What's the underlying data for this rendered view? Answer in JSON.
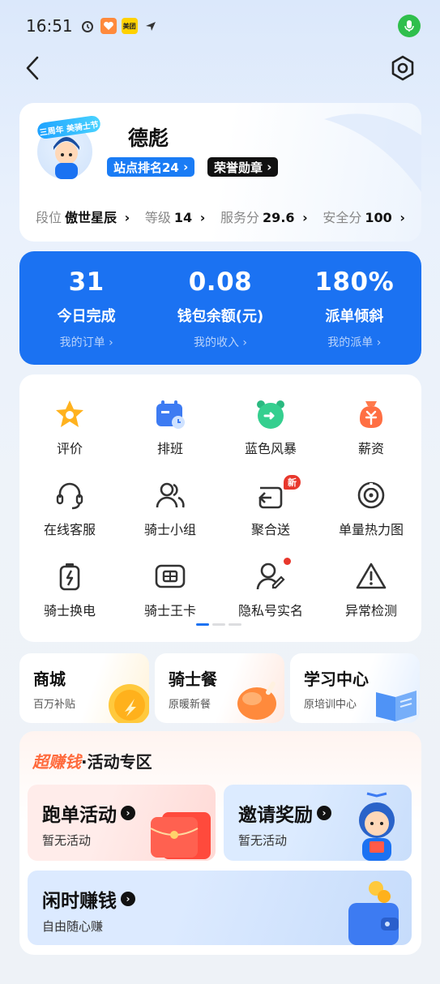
{
  "status_bar": {
    "time": "16:51",
    "app_badge": "美团"
  },
  "profile": {
    "name": "德彪",
    "avatar_badge": "三周年 美骑士节",
    "station_rank": "站点排名24",
    "honor": "荣誉勋章",
    "stats": [
      {
        "label": "段位",
        "value": "傲世星辰"
      },
      {
        "label": "等级",
        "value": "14"
      },
      {
        "label": "服务分",
        "value": "29.6"
      },
      {
        "label": "安全分",
        "value": "100"
      }
    ]
  },
  "summary": [
    {
      "value": "31",
      "label": "今日完成",
      "sub": "我的订单"
    },
    {
      "value": "0.08",
      "label": "钱包余额(元)",
      "sub": "我的收入"
    },
    {
      "value": "180%",
      "label": "派单倾斜",
      "sub": "我的派单"
    }
  ],
  "features": [
    {
      "label": "评价",
      "icon": "star-icon"
    },
    {
      "label": "排班",
      "icon": "calendar-icon"
    },
    {
      "label": "蓝色风暴",
      "icon": "alarm-clock-icon"
    },
    {
      "label": "薪资",
      "icon": "money-bag-icon"
    },
    {
      "label": "在线客服",
      "icon": "headset-icon"
    },
    {
      "label": "骑士小组",
      "icon": "group-icon"
    },
    {
      "label": "聚合送",
      "icon": "merge-delivery-icon",
      "badge": "新"
    },
    {
      "label": "单量热力图",
      "icon": "heatmap-icon"
    },
    {
      "label": "骑士换电",
      "icon": "battery-icon"
    },
    {
      "label": "骑士王卡",
      "icon": "sim-card-icon"
    },
    {
      "label": "隐私号实名",
      "icon": "privacy-user-icon",
      "dot": true
    },
    {
      "label": "异常检测",
      "icon": "warning-icon"
    }
  ],
  "mini_cards": [
    {
      "title": "商城",
      "sub": "百万补贴"
    },
    {
      "title": "骑士餐",
      "sub": "原暖新餐"
    },
    {
      "title": "学习中心",
      "sub": "原培训中心"
    }
  ],
  "activity": {
    "hot_tag": "超赚钱",
    "title": "·活动专区",
    "tiles": [
      {
        "title": "跑单活动",
        "sub": "暂无活动"
      },
      {
        "title": "邀请奖励",
        "sub": "暂无活动"
      },
      {
        "title": "闲时赚钱",
        "sub": "自由随心赚"
      }
    ]
  },
  "colors": {
    "primary_blue": "#1b72f2",
    "accent_orange": "#ff6a3c",
    "badge_red": "#e8372c"
  }
}
